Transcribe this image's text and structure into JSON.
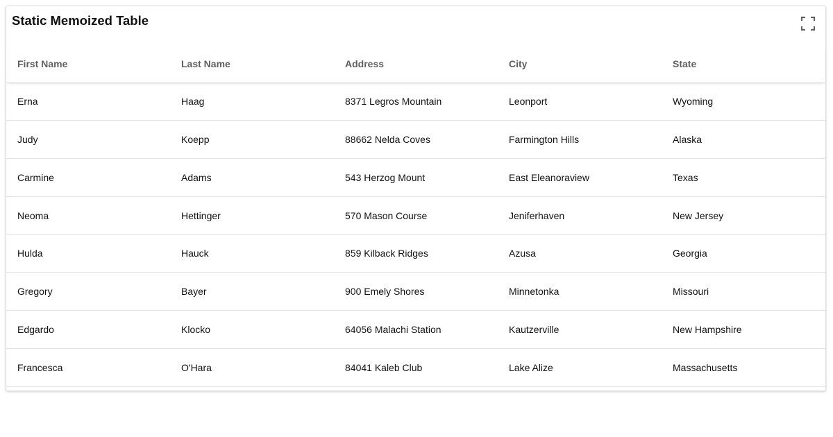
{
  "card": {
    "title": "Static Memoized Table"
  },
  "icons": {
    "fullscreen": "fullscreen-icon"
  },
  "colors": {
    "header_text": "#5f5f5f",
    "body_text": "#111111",
    "border": "#e3e3e3"
  },
  "table": {
    "columns": [
      "First Name",
      "Last Name",
      "Address",
      "City",
      "State"
    ],
    "rows": [
      [
        "Erna",
        "Haag",
        "8371 Legros Mountain",
        "Leonport",
        "Wyoming"
      ],
      [
        "Judy",
        "Koepp",
        "88662 Nelda Coves",
        "Farmington Hills",
        "Alaska"
      ],
      [
        "Carmine",
        "Adams",
        "543 Herzog Mount",
        "East Eleanoraview",
        "Texas"
      ],
      [
        "Neoma",
        "Hettinger",
        "570 Mason Course",
        "Jeniferhaven",
        "New Jersey"
      ],
      [
        "Hulda",
        "Hauck",
        "859 Kilback Ridges",
        "Azusa",
        "Georgia"
      ],
      [
        "Gregory",
        "Bayer",
        "900 Emely Shores",
        "Minnetonka",
        "Missouri"
      ],
      [
        "Edgardo",
        "Klocko",
        "64056 Malachi Station",
        "Kautzerville",
        "New Hampshire"
      ],
      [
        "Francesca",
        "O'Hara",
        "84041 Kaleb Club",
        "Lake Alize",
        "Massachusetts"
      ]
    ]
  }
}
